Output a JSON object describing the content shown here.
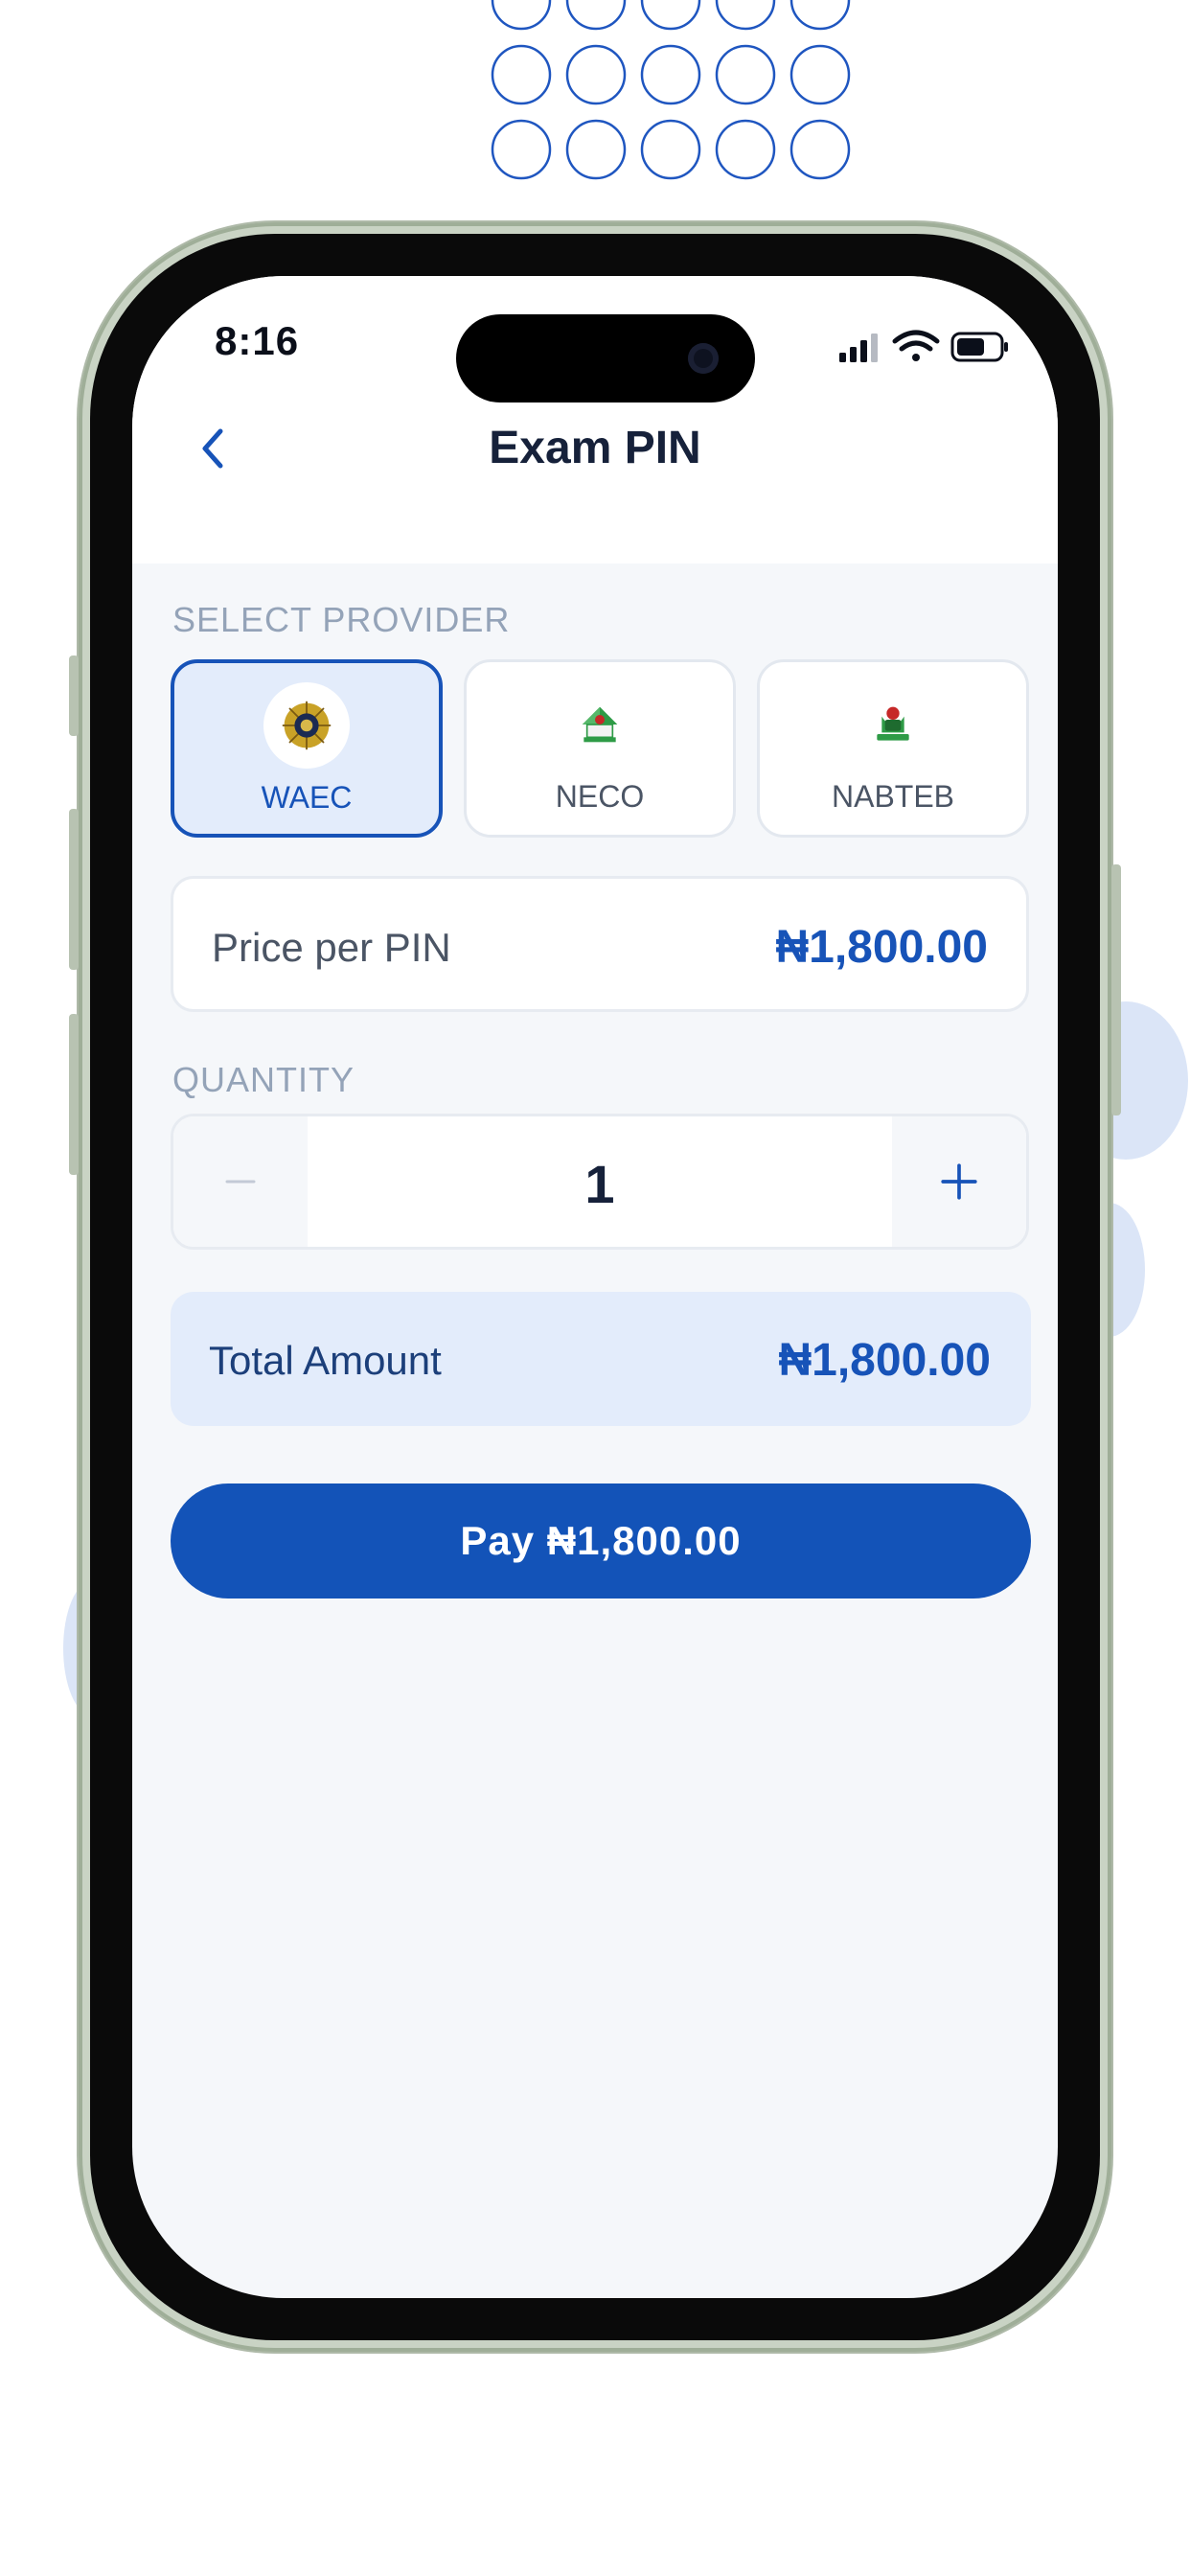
{
  "status_bar": {
    "time": "8:16"
  },
  "header": {
    "title": "Exam PIN",
    "back_icon": "chevron-left-icon"
  },
  "provider_section": {
    "label": "SELECT PROVIDER",
    "providers": [
      {
        "name": "WAEC",
        "selected": true,
        "icon": "waec-logo-icon"
      },
      {
        "name": "NECO",
        "selected": false,
        "icon": "neco-logo-icon"
      },
      {
        "name": "NABTEB",
        "selected": false,
        "icon": "nabteb-logo-icon"
      }
    ]
  },
  "price": {
    "label": "Price per PIN",
    "value": "₦1,800.00"
  },
  "quantity": {
    "label": "QUANTITY",
    "value": "1",
    "minus_icon": "minus-icon",
    "plus_icon": "plus-icon"
  },
  "total": {
    "label": "Total Amount",
    "value": "₦1,800.00"
  },
  "pay_button": {
    "label": "Pay ₦1,800.00"
  },
  "colors": {
    "primary": "#1353b8",
    "selected_bg": "#e3ecfb",
    "muted_label": "#94a3b8",
    "screen_bg": "#f5f7fa"
  }
}
